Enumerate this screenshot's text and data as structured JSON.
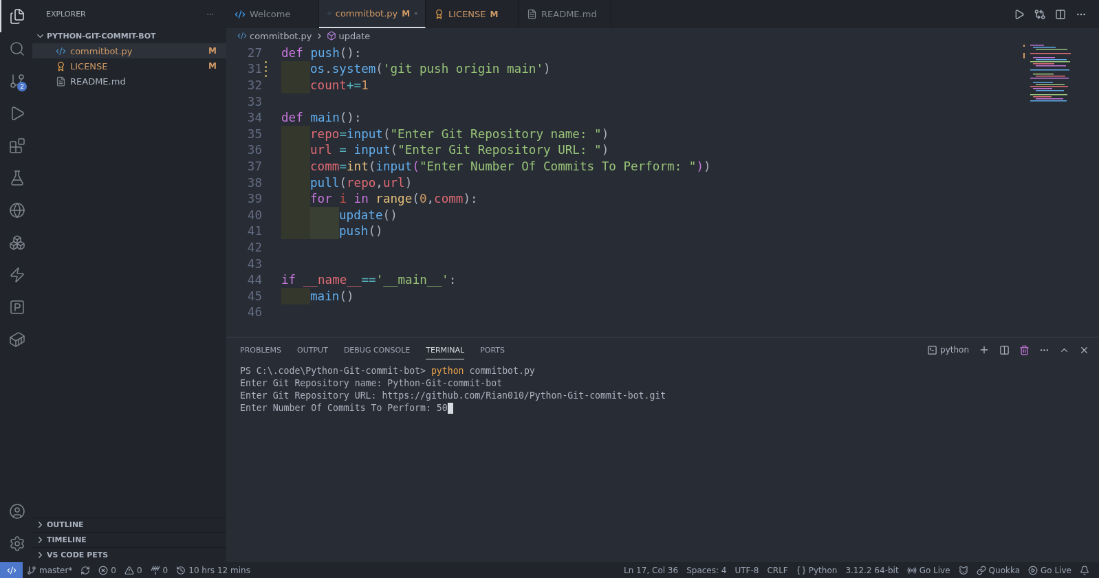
{
  "activity_bar": {
    "items": [
      {
        "selected": true
      },
      {
        "selected": false
      },
      {
        "selected": false,
        "badge": "2"
      },
      {
        "selected": false
      },
      {
        "selected": false
      },
      {
        "selected": false
      },
      {
        "selected": false
      },
      {
        "selected": false
      },
      {
        "selected": false
      },
      {
        "selected": false
      },
      {
        "selected": false
      }
    ]
  },
  "sidebar": {
    "title": "EXPLORER",
    "more": "···",
    "folder": {
      "name": "PYTHON-GIT-COMMIT-BOT",
      "expanded": true,
      "children": [
        {
          "name": "commitbot.py",
          "kind": "python",
          "status": "M",
          "selected": true,
          "modified": true
        },
        {
          "name": "LICENSE",
          "kind": "license",
          "status": "M",
          "selected": false,
          "modified": true
        },
        {
          "name": "README.md",
          "kind": "markdown",
          "selected": false,
          "modified": false
        }
      ]
    },
    "sections": [
      {
        "title": "OUTLINE",
        "expanded": false
      },
      {
        "title": "TIMELINE",
        "expanded": false
      },
      {
        "title": "VS CODE PETS",
        "expanded": false
      }
    ]
  },
  "tabs": [
    {
      "label": "Welcome",
      "kind": "welcome",
      "selected": false,
      "modified": false
    },
    {
      "label": "commitbot.py",
      "kind": "python",
      "selected": true,
      "modified": true,
      "status": "M"
    },
    {
      "label": "LICENSE",
      "kind": "license",
      "selected": false,
      "modified": true,
      "status": "M"
    },
    {
      "label": "README.md",
      "kind": "markdown",
      "selected": false,
      "modified": false
    }
  ],
  "breadcrumb": [
    "commitbot.py",
    "update"
  ],
  "code": [
    {
      "n": "27",
      "kind": "top",
      "tokens": [
        {
          "kind": "keyword",
          "t": "def "
        },
        {
          "kind": "function",
          "t": "push"
        },
        {
          "kind": "punctuation",
          "t": "():"
        }
      ]
    },
    {
      "n": "31",
      "kind": "body",
      "changed": true,
      "tokens": [
        {
          "kind": "function",
          "t": "os"
        },
        {
          "kind": "punctuation",
          "t": "."
        },
        {
          "kind": "function",
          "t": "system"
        },
        {
          "kind": "punctuation",
          "t": "("
        },
        {
          "kind": "string",
          "t": "'git push origin main'"
        },
        {
          "kind": "punctuation",
          "t": ")"
        }
      ]
    },
    {
      "n": "32",
      "kind": "body",
      "tokens": [
        {
          "kind": "variable",
          "t": "count"
        },
        {
          "kind": "operator",
          "t": "+="
        },
        {
          "kind": "number",
          "t": "1"
        }
      ]
    },
    {
      "n": "33",
      "kind": "top"
    },
    {
      "n": "34",
      "kind": "top",
      "tokens": [
        {
          "kind": "keyword",
          "t": "def "
        },
        {
          "kind": "function",
          "t": "main"
        },
        {
          "kind": "punctuation",
          "t": "():"
        }
      ]
    },
    {
      "n": "35",
      "kind": "body",
      "tokens": [
        {
          "kind": "variable",
          "t": "repo"
        },
        {
          "kind": "operator",
          "t": "="
        },
        {
          "kind": "function",
          "t": "input"
        },
        {
          "kind": "punctuation",
          "t": "("
        },
        {
          "kind": "string",
          "t": "\"Enter Git Repository name: \""
        },
        {
          "kind": "punctuation",
          "t": ")"
        }
      ]
    },
    {
      "n": "36",
      "kind": "body",
      "tokens": [
        {
          "kind": "variable",
          "t": "url"
        },
        {
          "kind": "operator",
          "t": " = "
        },
        {
          "kind": "function",
          "t": "input"
        },
        {
          "kind": "punctuation",
          "t": "("
        },
        {
          "kind": "string",
          "t": "\"Enter Git Repository URL: \""
        },
        {
          "kind": "punctuation",
          "t": ")"
        }
      ]
    },
    {
      "n": "37",
      "kind": "body",
      "tokens": [
        {
          "kind": "variable",
          "t": "comm"
        },
        {
          "kind": "operator",
          "t": "="
        },
        {
          "kind": "builtin",
          "t": "int"
        },
        {
          "kind": "punctuation",
          "t": "("
        },
        {
          "kind": "function",
          "t": "input"
        },
        {
          "kind": "bracket",
          "t": "("
        },
        {
          "kind": "string",
          "t": "\"Enter Number Of Commits To Perform: \""
        },
        {
          "kind": "bracket",
          "t": ")"
        },
        {
          "kind": "punctuation",
          "t": ")"
        }
      ]
    },
    {
      "n": "38",
      "kind": "body",
      "tokens": [
        {
          "kind": "function",
          "t": "pull"
        },
        {
          "kind": "punctuation",
          "t": "("
        },
        {
          "kind": "variable",
          "t": "repo"
        },
        {
          "kind": "punctuation",
          "t": ","
        },
        {
          "kind": "variable",
          "t": "url"
        },
        {
          "kind": "punctuation",
          "t": ")"
        }
      ]
    },
    {
      "n": "39",
      "kind": "body",
      "tokens": [
        {
          "kind": "keyword",
          "t": "for "
        },
        {
          "kind": "loopvar",
          "t": "i "
        },
        {
          "kind": "keyword",
          "t": "in "
        },
        {
          "kind": "builtin",
          "t": "range"
        },
        {
          "kind": "punctuation",
          "t": "("
        },
        {
          "kind": "number",
          "t": "0"
        },
        {
          "kind": "punctuation",
          "t": ","
        },
        {
          "kind": "variable",
          "t": "comm"
        },
        {
          "kind": "punctuation",
          "t": "):"
        }
      ]
    },
    {
      "n": "40",
      "kind": "inner",
      "tokens": [
        {
          "kind": "function",
          "t": "update"
        },
        {
          "kind": "punctuation",
          "t": "()"
        }
      ]
    },
    {
      "n": "41",
      "kind": "inner",
      "tokens": [
        {
          "kind": "function",
          "t": "push"
        },
        {
          "kind": "punctuation",
          "t": "()"
        }
      ]
    },
    {
      "n": "42",
      "kind": "top"
    },
    {
      "n": "43",
      "kind": "top"
    },
    {
      "n": "44",
      "kind": "top",
      "tokens": [
        {
          "kind": "keyword",
          "t": "if "
        },
        {
          "kind": "variable",
          "t": "__name__"
        },
        {
          "kind": "operator",
          "t": "=="
        },
        {
          "kind": "string",
          "t": "'__main__'"
        },
        {
          "kind": "punctuation",
          "t": ":"
        }
      ]
    },
    {
      "n": "45",
      "kind": "body",
      "tokens": [
        {
          "kind": "function",
          "t": "main"
        },
        {
          "kind": "punctuation",
          "t": "()"
        }
      ]
    },
    {
      "n": "46",
      "kind": "top"
    }
  ],
  "panel": {
    "tabs": [
      {
        "label": "PROBLEMS",
        "selected": false
      },
      {
        "label": "OUTPUT",
        "selected": false
      },
      {
        "label": "DEBUG CONSOLE",
        "selected": false
      },
      {
        "label": "TERMINAL",
        "selected": true
      },
      {
        "label": "PORTS",
        "selected": false
      }
    ],
    "terminal_name": "python",
    "terminal": [
      {
        "prompt": "PS C:\\.code\\Python-Git-commit-bot>",
        "command": "python",
        "args": "commitbot.py"
      },
      {
        "text": "Enter Git Repository name: Python-Git-commit-bot"
      },
      {
        "text": "Enter Git Repository URL: https://github.com/Rian010/Python-Git-commit-bot.git"
      },
      {
        "text": "Enter Number Of Commits To Perform: 50",
        "cursor": true
      }
    ]
  },
  "status_bar": {
    "left": [
      {
        "kind": "label",
        "text": "master*"
      },
      {
        "kind": "icon"
      },
      {
        "kind": "label",
        "text": "0"
      },
      {
        "kind": "label",
        "text": "0"
      },
      {
        "kind": "label",
        "text": "0"
      },
      {
        "kind": "label",
        "text": "10 hrs 12 mins"
      }
    ],
    "right": [
      {
        "kind": "label",
        "text": "Ln 17, Col 36"
      },
      {
        "kind": "label",
        "text": "Spaces: 4"
      },
      {
        "kind": "label",
        "text": "UTF-8"
      },
      {
        "kind": "label",
        "text": "CRLF"
      },
      {
        "kind": "label",
        "text": "Python"
      },
      {
        "kind": "label",
        "text": "3.12.2 64-bit"
      },
      {
        "kind": "label",
        "text": "Go Live"
      },
      {
        "kind": "icon"
      },
      {
        "kind": "label",
        "text": "Quokka"
      },
      {
        "kind": "label",
        "text": "Go Live"
      },
      {
        "kind": "icon"
      }
    ]
  }
}
